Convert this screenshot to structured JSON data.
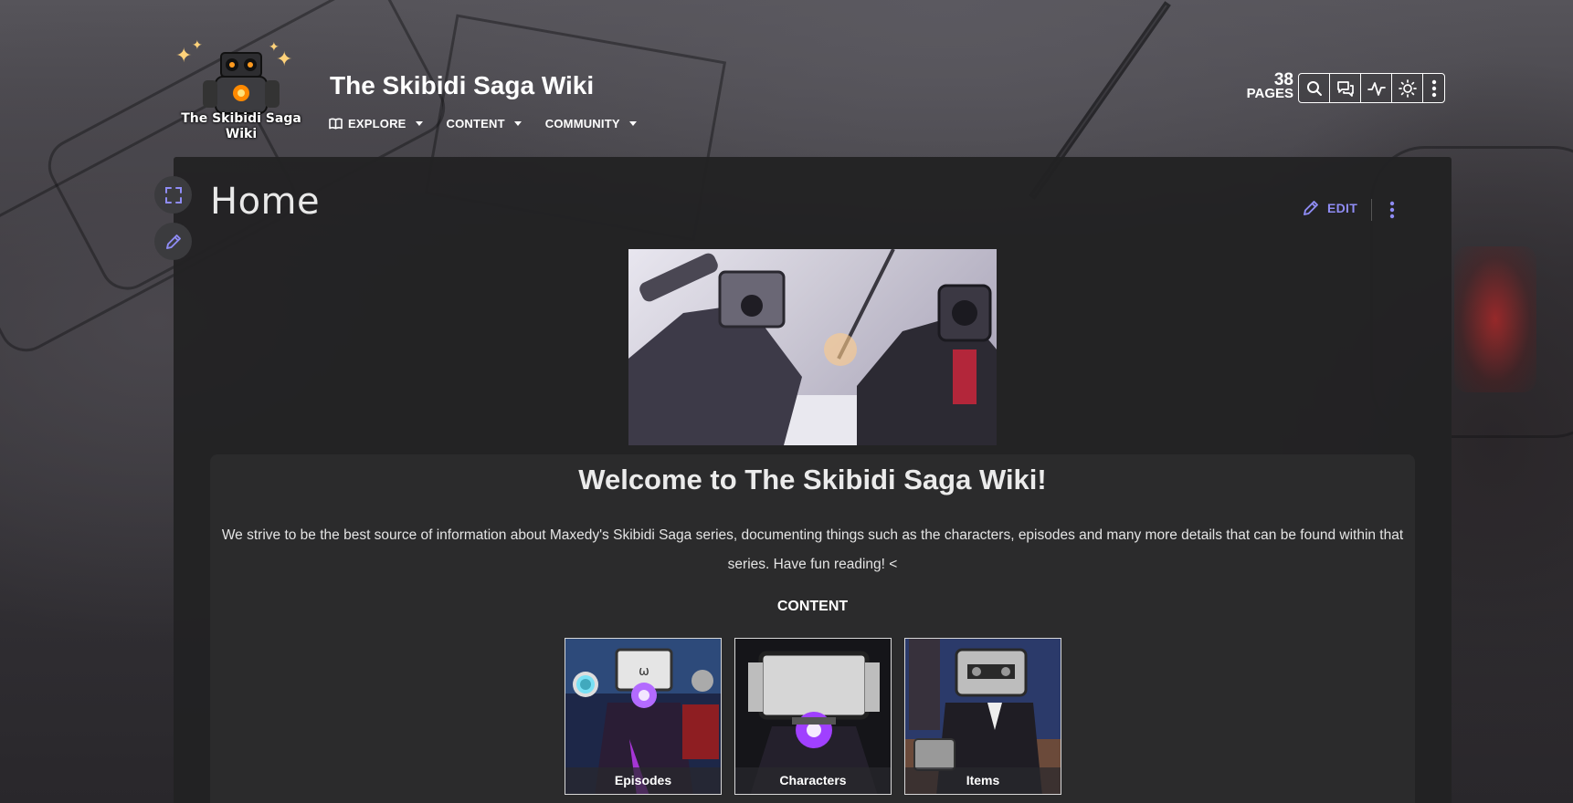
{
  "site": {
    "logo_text": "The Skibidi Saga Wiki",
    "title": "The Skibidi Saga Wiki"
  },
  "nav": [
    {
      "label": "EXPLORE",
      "icon": "book-icon"
    },
    {
      "label": "CONTENT",
      "icon": ""
    },
    {
      "label": "COMMUNITY",
      "icon": ""
    }
  ],
  "stats": {
    "pages_count": "38",
    "pages_label": "PAGES"
  },
  "tools": [
    "search-icon",
    "discussions-icon",
    "activity-icon",
    "theme-toggle-icon",
    "more-options-icon"
  ],
  "page": {
    "title": "Home",
    "edit_label": "EDIT"
  },
  "welcome": {
    "title": "Welcome to The Skibidi Saga Wiki!",
    "text": "We strive to be the best source of information about Maxedy's Skibidi Saga series, documenting things such as the characters, episodes and many more details that can be found within that series. Have fun reading! <",
    "content_heading": "CONTENT"
  },
  "cards": [
    {
      "label": "Episodes"
    },
    {
      "label": "Characters"
    },
    {
      "label": "Items"
    }
  ],
  "colors": {
    "accent": "#8f8cf5",
    "panel": "#222223",
    "welcome_box": "#2b2b2c"
  }
}
